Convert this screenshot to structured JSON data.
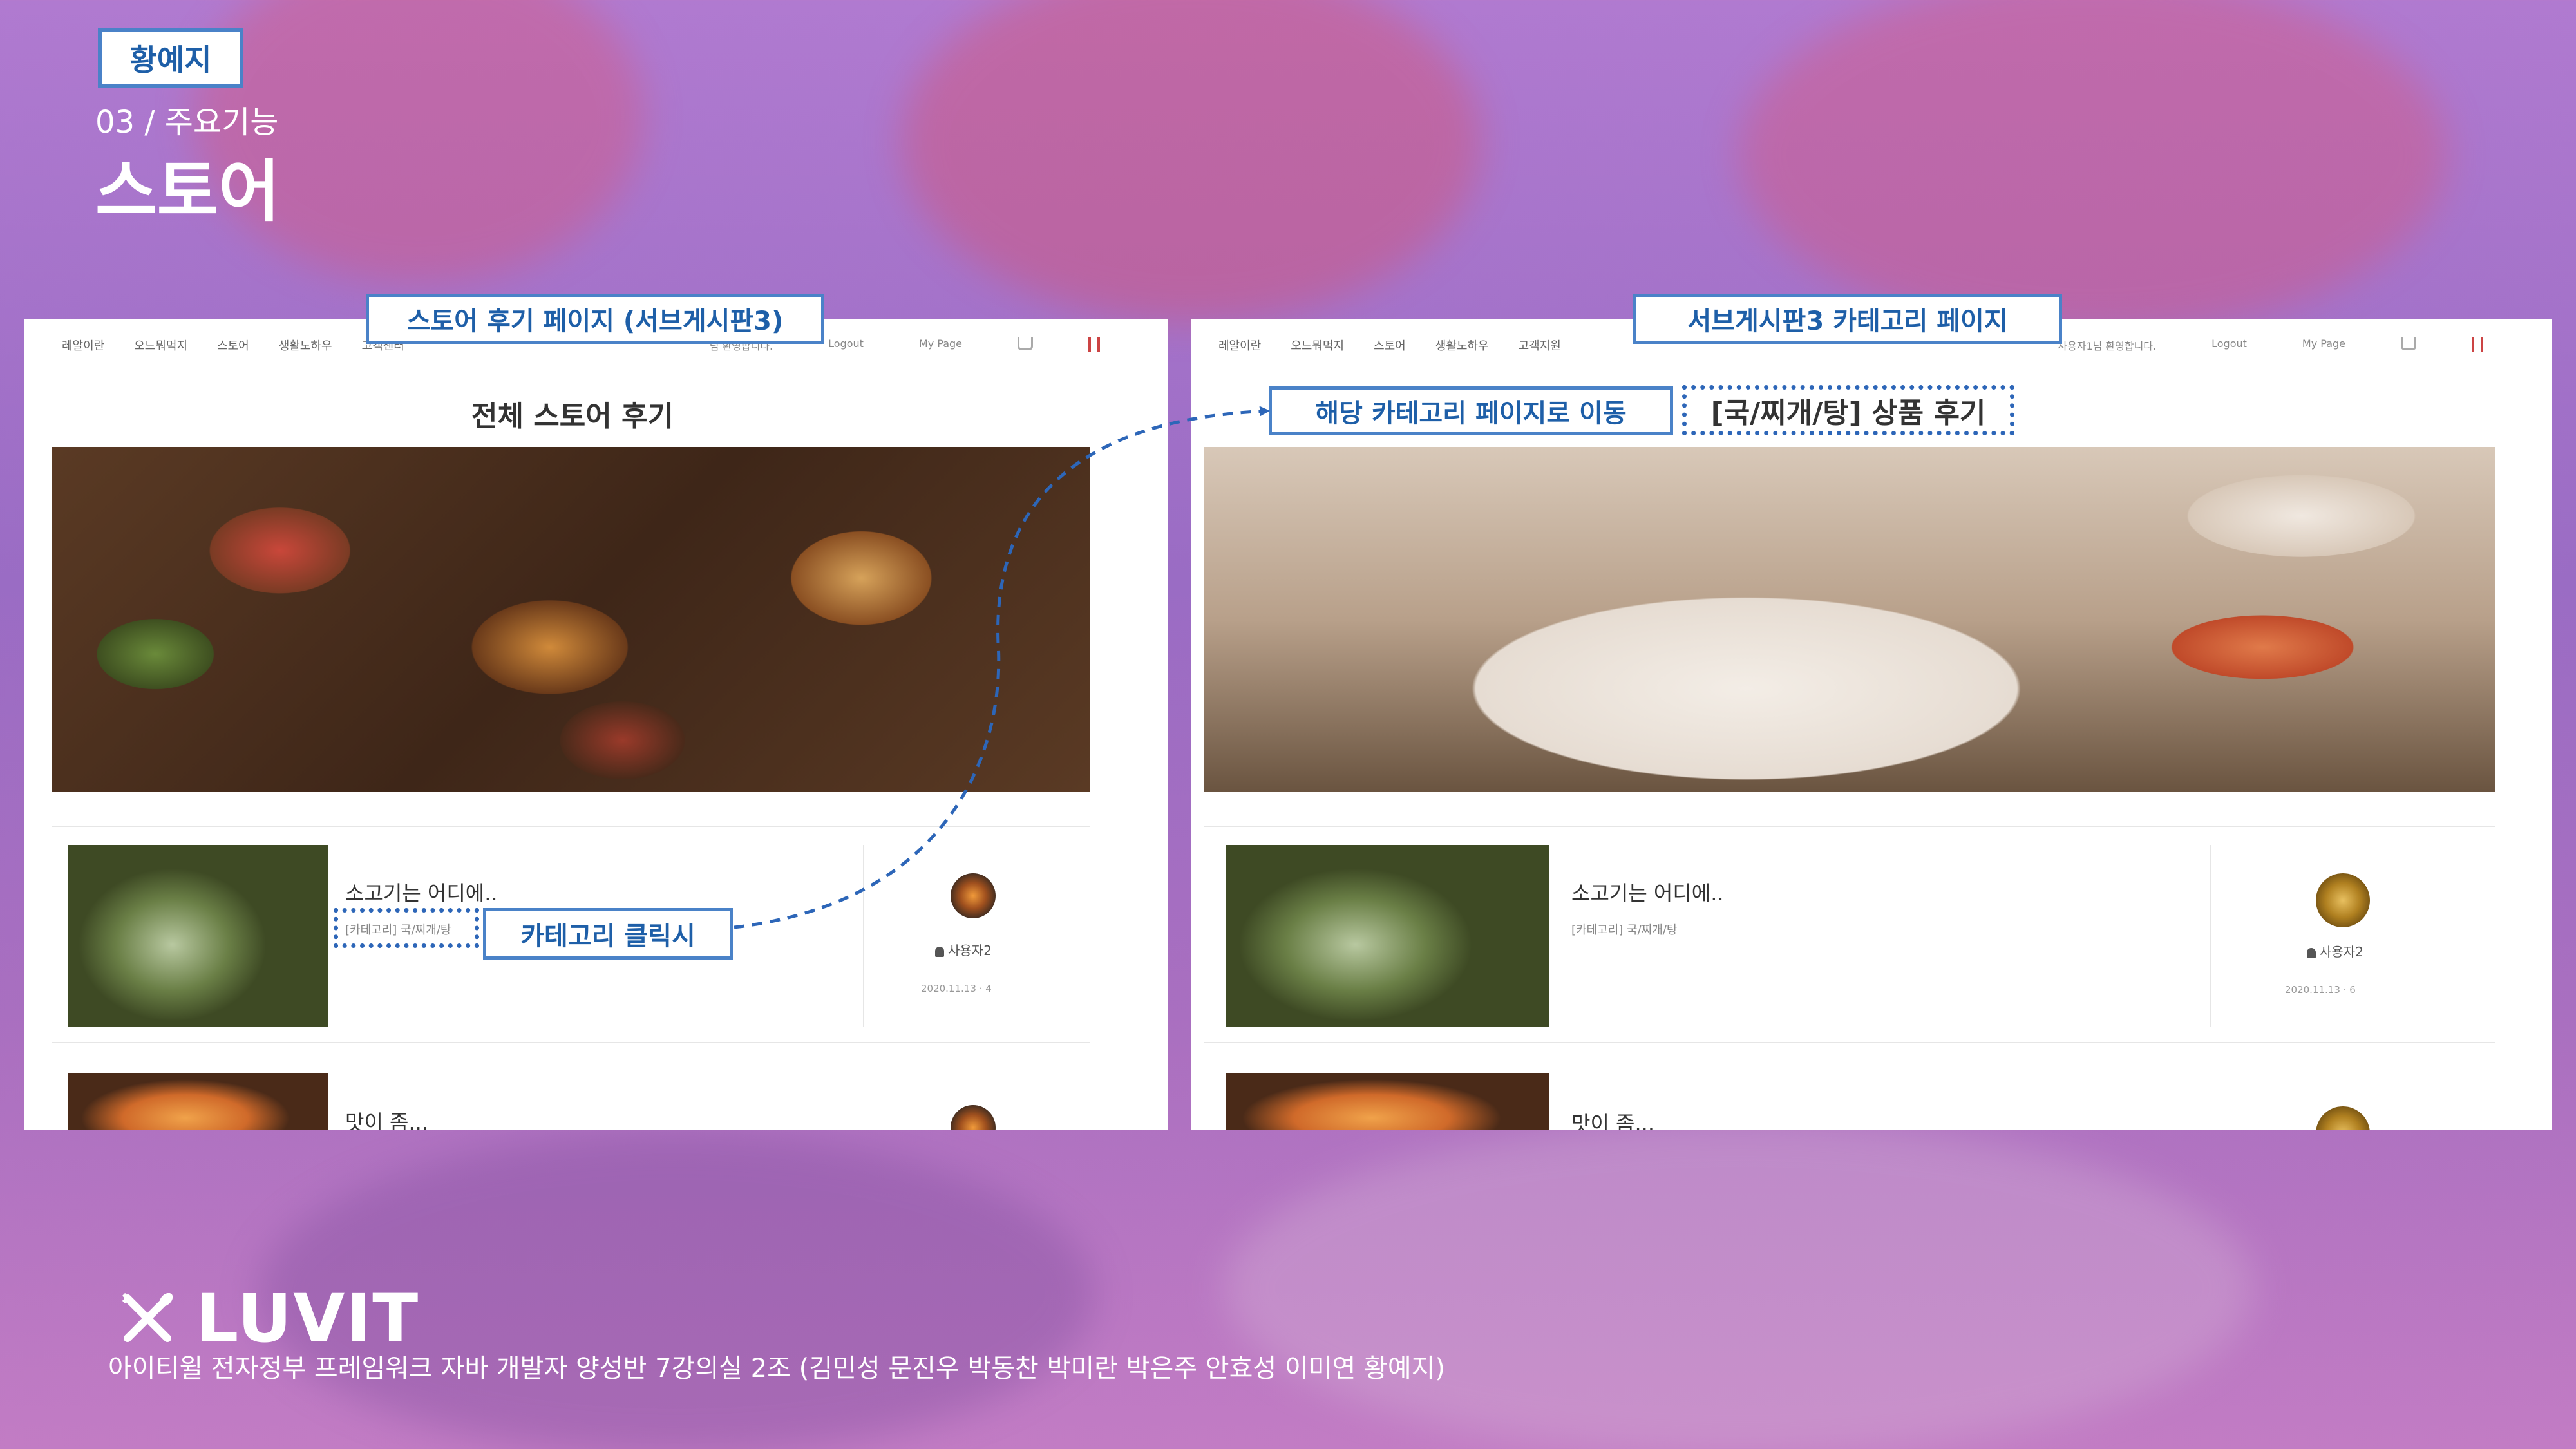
{
  "header": {
    "author_tag": "황예지",
    "section_label": "03 / 주요기능",
    "section_title": "스토어"
  },
  "callouts": {
    "left_panel": "스토어 후기 페이지 (서브게시판3)",
    "right_panel": "서브게시판3 카테고리 페이지",
    "move_to_category": "해당 카테고리 페이지로 이동",
    "on_category_click": "카테고리 클릭시",
    "category_heading": "[국/찌개/탕] 상품 후기"
  },
  "left_page": {
    "nav": [
      "레알이란",
      "오느뭐먹지",
      "스토어",
      "생활노하우",
      "고객센터"
    ],
    "nav_right": [
      "님 환영합니다.",
      "Logout",
      "My Page"
    ],
    "heading": "전체 스토어 후기",
    "posts": [
      {
        "title": "소고기는 어디에..",
        "category": "[카테고리] 국/찌개/탕",
        "user": "사용자2",
        "date": "2020.11.13 · 4"
      },
      {
        "title": "맛이 좀..."
      }
    ]
  },
  "right_page": {
    "nav": [
      "레알이란",
      "오느뭐먹지",
      "스토어",
      "생활노하우",
      "고객지원"
    ],
    "nav_right": [
      "사용자1님 환영합니다.",
      "Logout",
      "My Page"
    ],
    "posts": [
      {
        "title": "소고기는 어디에..",
        "category": "[카테고리] 국/찌개/탕",
        "user": "사용자2",
        "date": "2020.11.13 · 6"
      },
      {
        "title": "맛이 좀..."
      }
    ]
  },
  "footer": {
    "logo": "LUVIT",
    "credits": "아이티윌 전자정부 프레임워크 자바 개발자 양성반 7강의실 2조 (김민성 문진우 박동찬 박미란 박은주 안효성 이미연 황예지)"
  },
  "colors": {
    "callout_border": "#4a82c8",
    "callout_text": "#1e5fa8",
    "arrow": "#2d66b8"
  }
}
